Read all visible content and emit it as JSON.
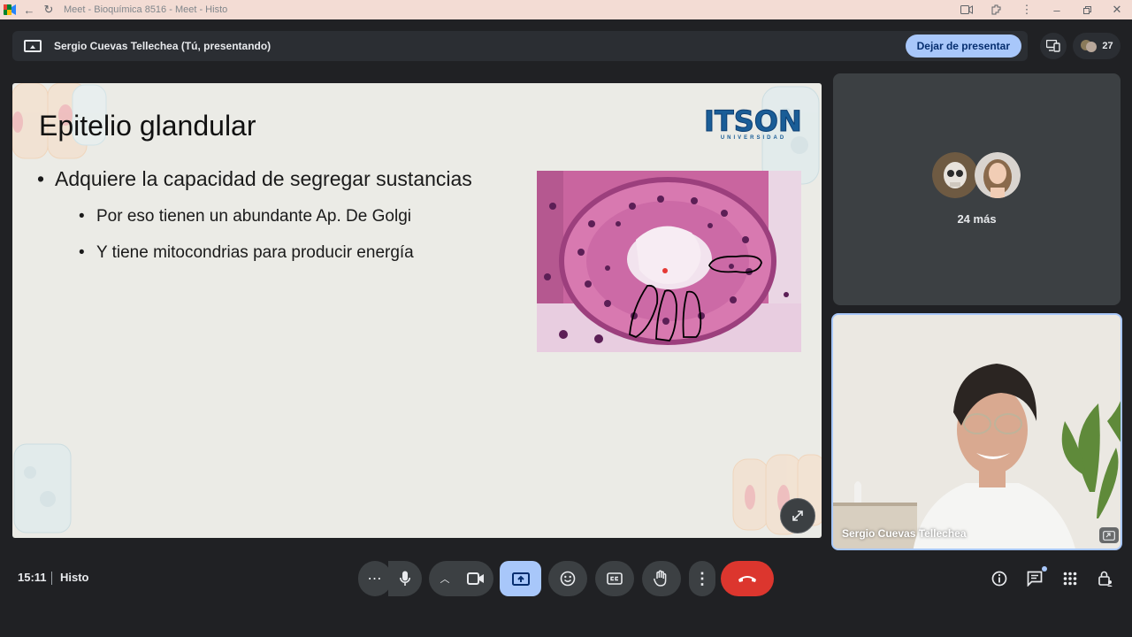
{
  "browser": {
    "tab_title": "Meet - Bioquímica 8516 - Meet - Histo"
  },
  "presenting": {
    "label": "Sergio Cuevas Tellechea (Tú, presentando)",
    "stop_button": "Dejar de presentar",
    "participants_count": "27"
  },
  "slide": {
    "title": "Epitelio glandular",
    "bullet_main": "Adquiere la capacidad de segregar sustancias",
    "bullet_sub_1": "Por eso tienen un abundante Ap. De Golgi",
    "bullet_sub_2": "Y tiene mitocondrias para producir energía",
    "bullet_symbol": "•",
    "logo_text": "ITSON",
    "logo_subtext": "UNIVERSIDAD"
  },
  "tiles": {
    "others_label": "24 más",
    "self_name": "Sergio Cuevas Tellechea"
  },
  "footer": {
    "time": "15:11",
    "meeting_name": "Histo"
  },
  "colors": {
    "background": "#202124",
    "accent": "#a8c7fa",
    "end_call": "#dc362e",
    "logo_blue": "#1a5d97"
  }
}
